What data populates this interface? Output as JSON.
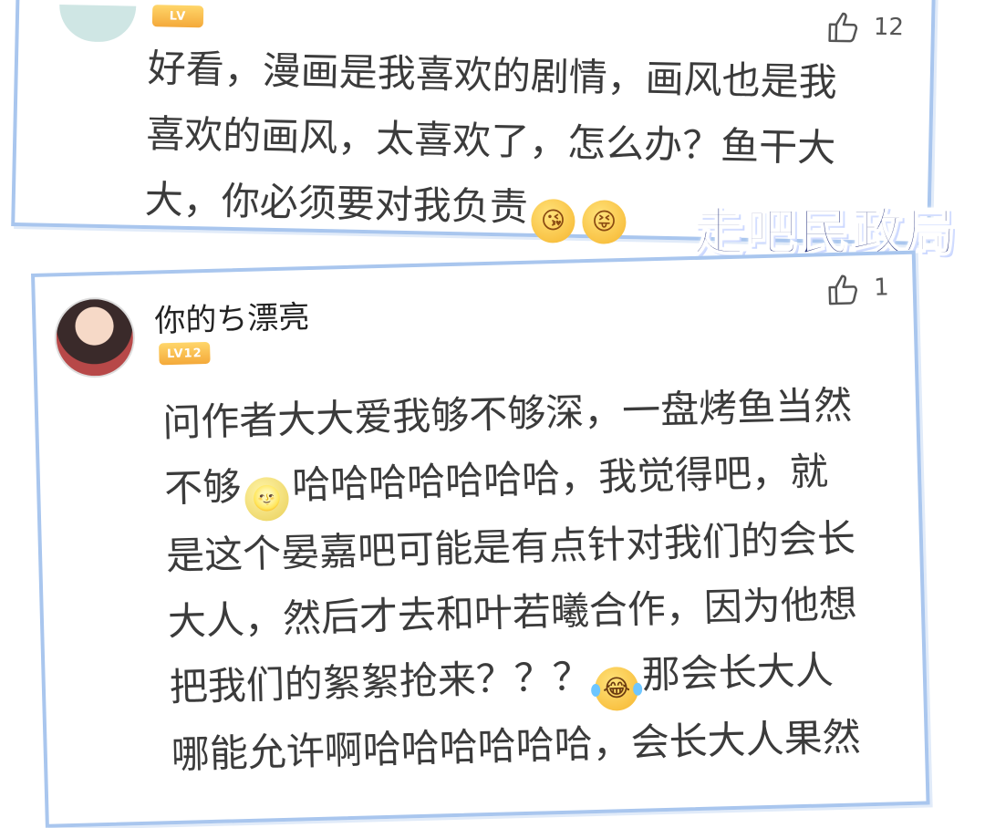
{
  "comment1": {
    "badge_text": "LV",
    "like_count": "12",
    "text": "好看，漫画是我喜欢的剧情，画风也是我\n喜欢的画风，太喜欢了，怎么办？鱼干大\n大，你必须要对我负责",
    "emojis": [
      "kissing-face",
      "squinting-tongue-face"
    ]
  },
  "caption": "走吧民政局",
  "comment2": {
    "username": "你的ち漂亮",
    "badge_text": "LV12",
    "like_count": "1",
    "text_a": "问作者大大爱我够不够深，一盘烤鱼当然\n不够",
    "text_b": "哈哈哈哈哈哈哈，我觉得吧，就\n是这个晏嘉吧可能是有点针对我们的会长\n大人，然后才去和叶若曦合作，因为他想\n把我们的絮絮抢来？？？",
    "text_c": "那会长大人\n哪能允许啊哈哈哈哈哈哈，会长大人果然",
    "emojis": [
      "moon-face",
      "tears-of-joy-face"
    ]
  },
  "colors": {
    "card_border": "#a9c6ee",
    "caption_text": "#1d2a78",
    "badge_gold": "#f4a93a"
  }
}
